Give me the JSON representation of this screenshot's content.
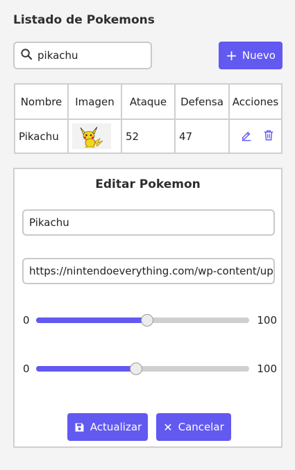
{
  "header": {
    "title": "Listado de Pokemons"
  },
  "search": {
    "value": "pikachu",
    "icon": "search-icon"
  },
  "new_button": {
    "label": "Nuevo",
    "icon": "plus-icon"
  },
  "table": {
    "columns": [
      "Nombre",
      "Imagen",
      "Ataque",
      "Defensa",
      "Acciones"
    ],
    "rows": [
      {
        "nombre": "Pikachu",
        "ataque": "52",
        "defensa": "47",
        "image": "pikachu-thumbnail"
      }
    ]
  },
  "editor": {
    "title": "Editar Pokemon",
    "name_value": "Pikachu",
    "image_url_value": "https://nintendoeverything.com/wp-content/uploads/pikachu.png",
    "attack_slider": {
      "min": "0",
      "max": "100",
      "value": 52
    },
    "defense_slider": {
      "min": "0",
      "max": "100",
      "value": 47
    },
    "update_label": "Actualizar",
    "cancel_label": "Cancelar"
  },
  "colors": {
    "accent": "#6259f1",
    "border": "#cfcfcf",
    "background": "#f4f4f4"
  }
}
